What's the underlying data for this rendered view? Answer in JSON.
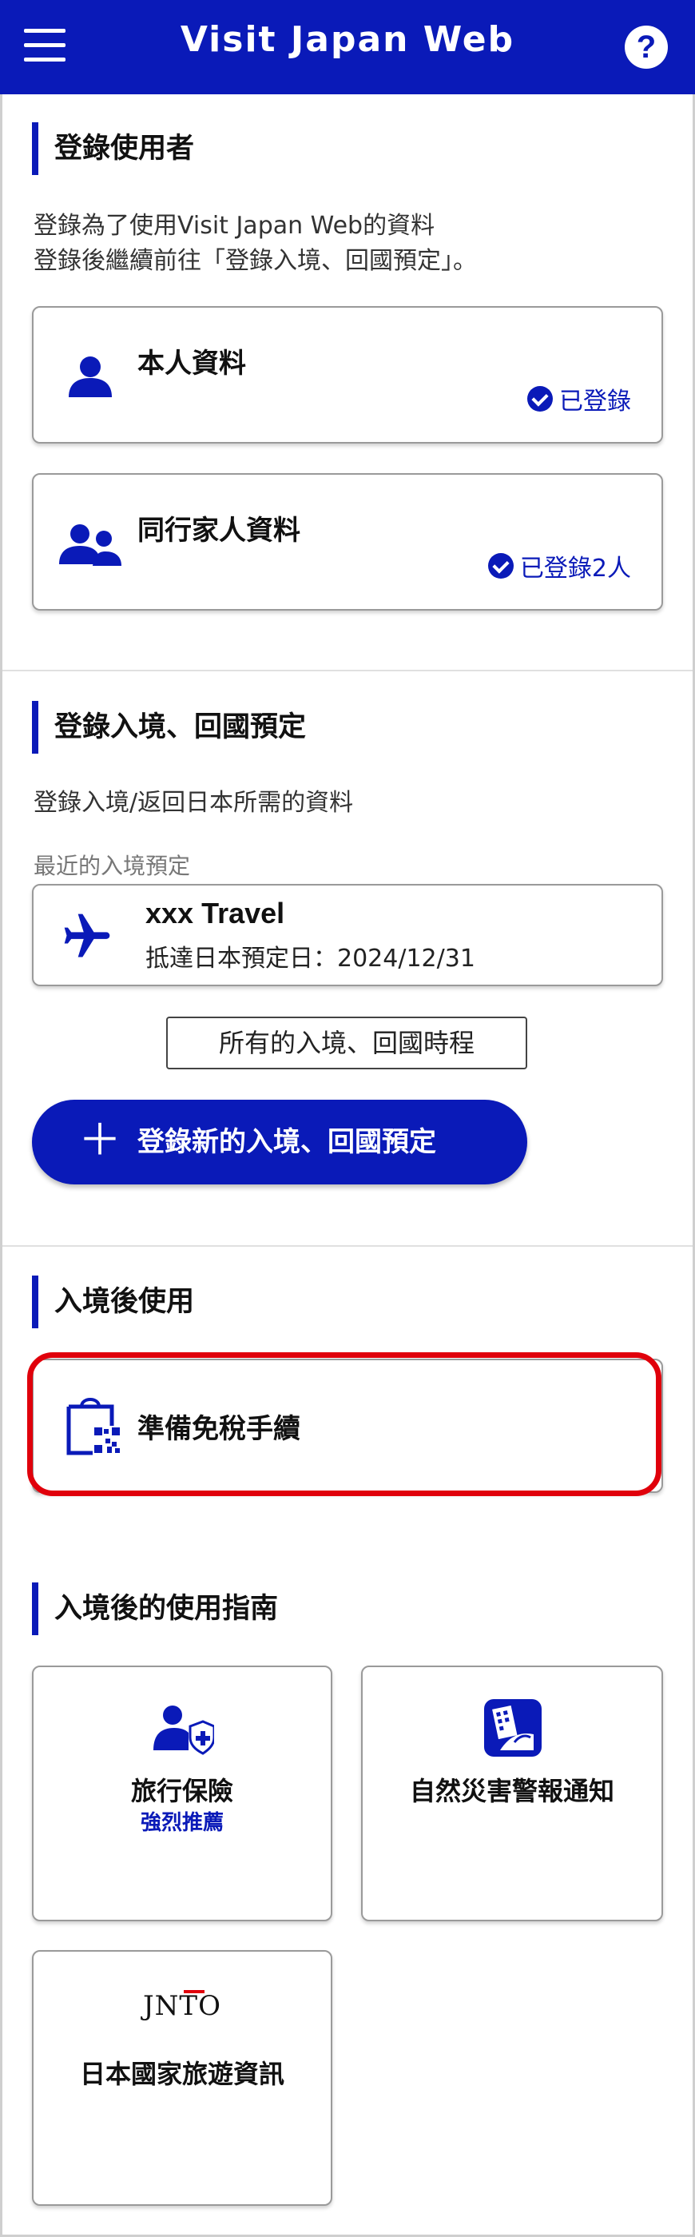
{
  "header": {
    "title": "Visit Japan Web",
    "help_symbol": "?"
  },
  "section_register": {
    "heading": "登錄使用者",
    "desc_line1": "登錄為了使用Visit Japan Web的資料",
    "desc_line2": "登錄後繼續前往「登錄入境、回國預定」。",
    "cards": [
      {
        "title": "本人資料",
        "status": "已登錄",
        "icon": "person-icon"
      },
      {
        "title": "同行家人資料",
        "status": "已登錄2人",
        "icon": "family-icon"
      }
    ]
  },
  "section_entry": {
    "heading": "登錄入境、回國預定",
    "desc": "登錄入境/返回日本所需的資料",
    "recent_label": "最近的入境預定",
    "trip": {
      "name": "xxx Travel",
      "arrival": "抵達日本預定日：2024/12/31",
      "icon": "airplane-icon"
    },
    "all_button": "所有的入境、回國時程",
    "new_button": "登錄新的入境、回國預定",
    "new_symbol": "＋"
  },
  "section_after": {
    "heading": "入境後使用",
    "card": {
      "title": "準備免稅手續",
      "icon": "taxfree-bag-qr-icon"
    }
  },
  "section_guide": {
    "heading": "入境後的使用指南",
    "tiles": [
      {
        "label": "旅行保險",
        "sub": "強烈推薦",
        "icon": "insurance-person-icon"
      },
      {
        "label": "自然災害警報通知",
        "icon": "disaster-building-icon"
      },
      {
        "label": "日本國家旅遊資訊",
        "logo_text": "JNTO",
        "icon": "jnto-logo"
      }
    ]
  },
  "colors": {
    "brand": "#0a1ab8",
    "highlight": "#e0000b"
  }
}
